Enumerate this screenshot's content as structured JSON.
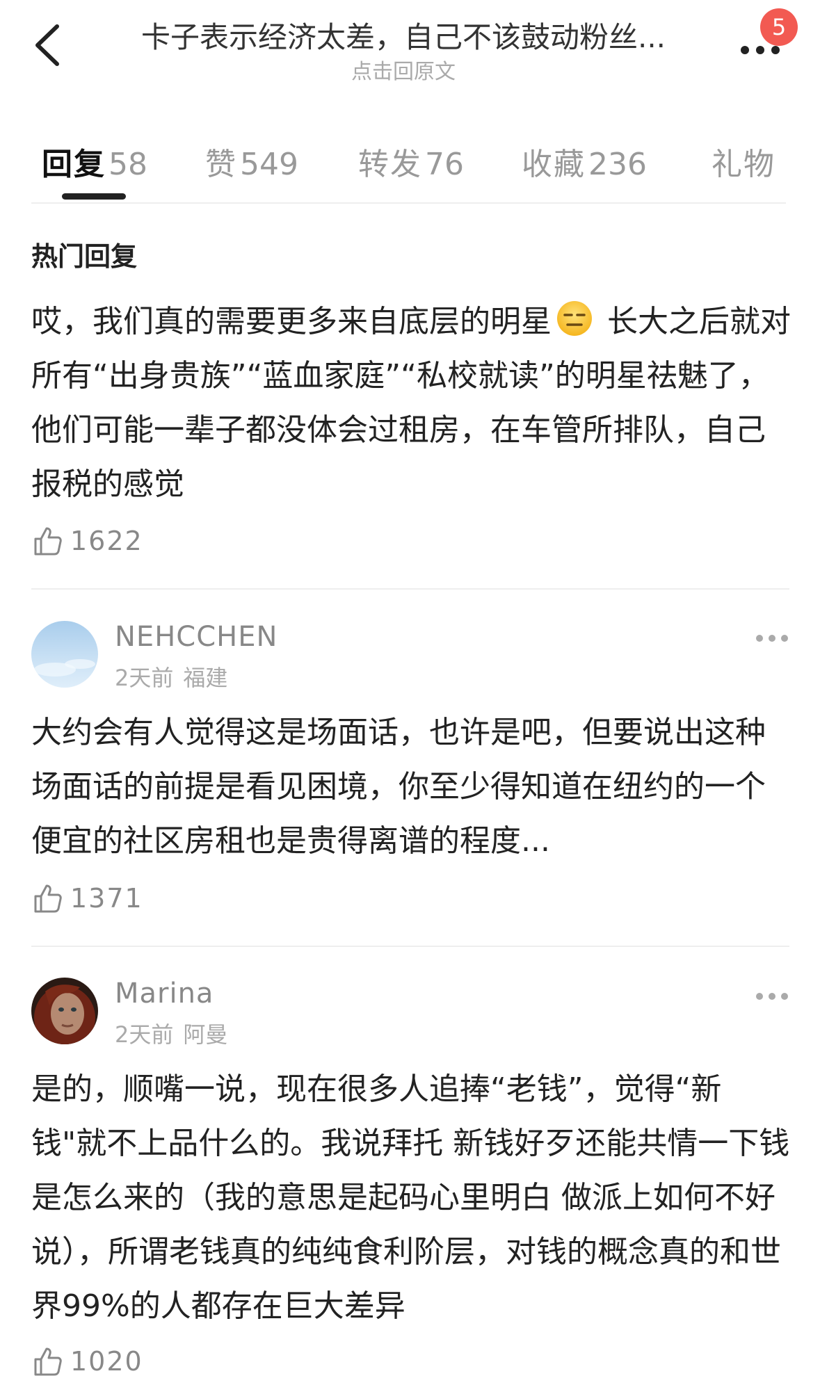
{
  "header": {
    "title": "卡子表示经济太差，自己不该鼓动粉丝...",
    "subtitle": "点击回原文",
    "badge_count": "5"
  },
  "tabs": [
    {
      "label": "回复",
      "count": "58",
      "active": true
    },
    {
      "label": "赞",
      "count": "549"
    },
    {
      "label": "转发",
      "count": "76"
    },
    {
      "label": "收藏",
      "count": "236"
    },
    {
      "label": "礼物",
      "count": ""
    }
  ],
  "section_title": "热门回复",
  "comments": [
    {
      "text_before_emoji": "哎，我们真的需要更多来自底层的明星",
      "emoji": "expressionless-face",
      "text_after_emoji": " 长大之后就对所有“出身贵族”“蓝血家庭”“私校就读”的明星祛魅了，他们可能一辈子都没体会过租房，在车管所排队，自己报税的感觉",
      "likes": "1622"
    },
    {
      "username": "NEHCCHEN",
      "time": "2天前",
      "location": "福建",
      "avatar": "sky-avatar",
      "text": "大约会有人觉得这是场面话，也许是吧，但要说出这种场面话的前提是看见困境，你至少得知道在纽约的一个便宜的社区房租也是贵得离谱的程度...",
      "likes": "1371"
    },
    {
      "username": "Marina",
      "time": "2天前",
      "location": "阿曼",
      "avatar": "portrait-avatar",
      "text": "是的，顺嘴一说，现在很多人追捧“老钱”，觉得“新钱\"就不上品什么的。我说拜托 新钱好歹还能共情一下钱是怎么来的（我的意思是起码心里明白 做派上如何不好说），所谓老钱真的纯纯食利阶层，对钱的概念真的和世界99%的人都存在巨大差异",
      "likes": "1020"
    }
  ],
  "colors": {
    "badge": "#f25a52",
    "text": "#222222",
    "muted": "#999999",
    "divider": "#eeeeee"
  }
}
